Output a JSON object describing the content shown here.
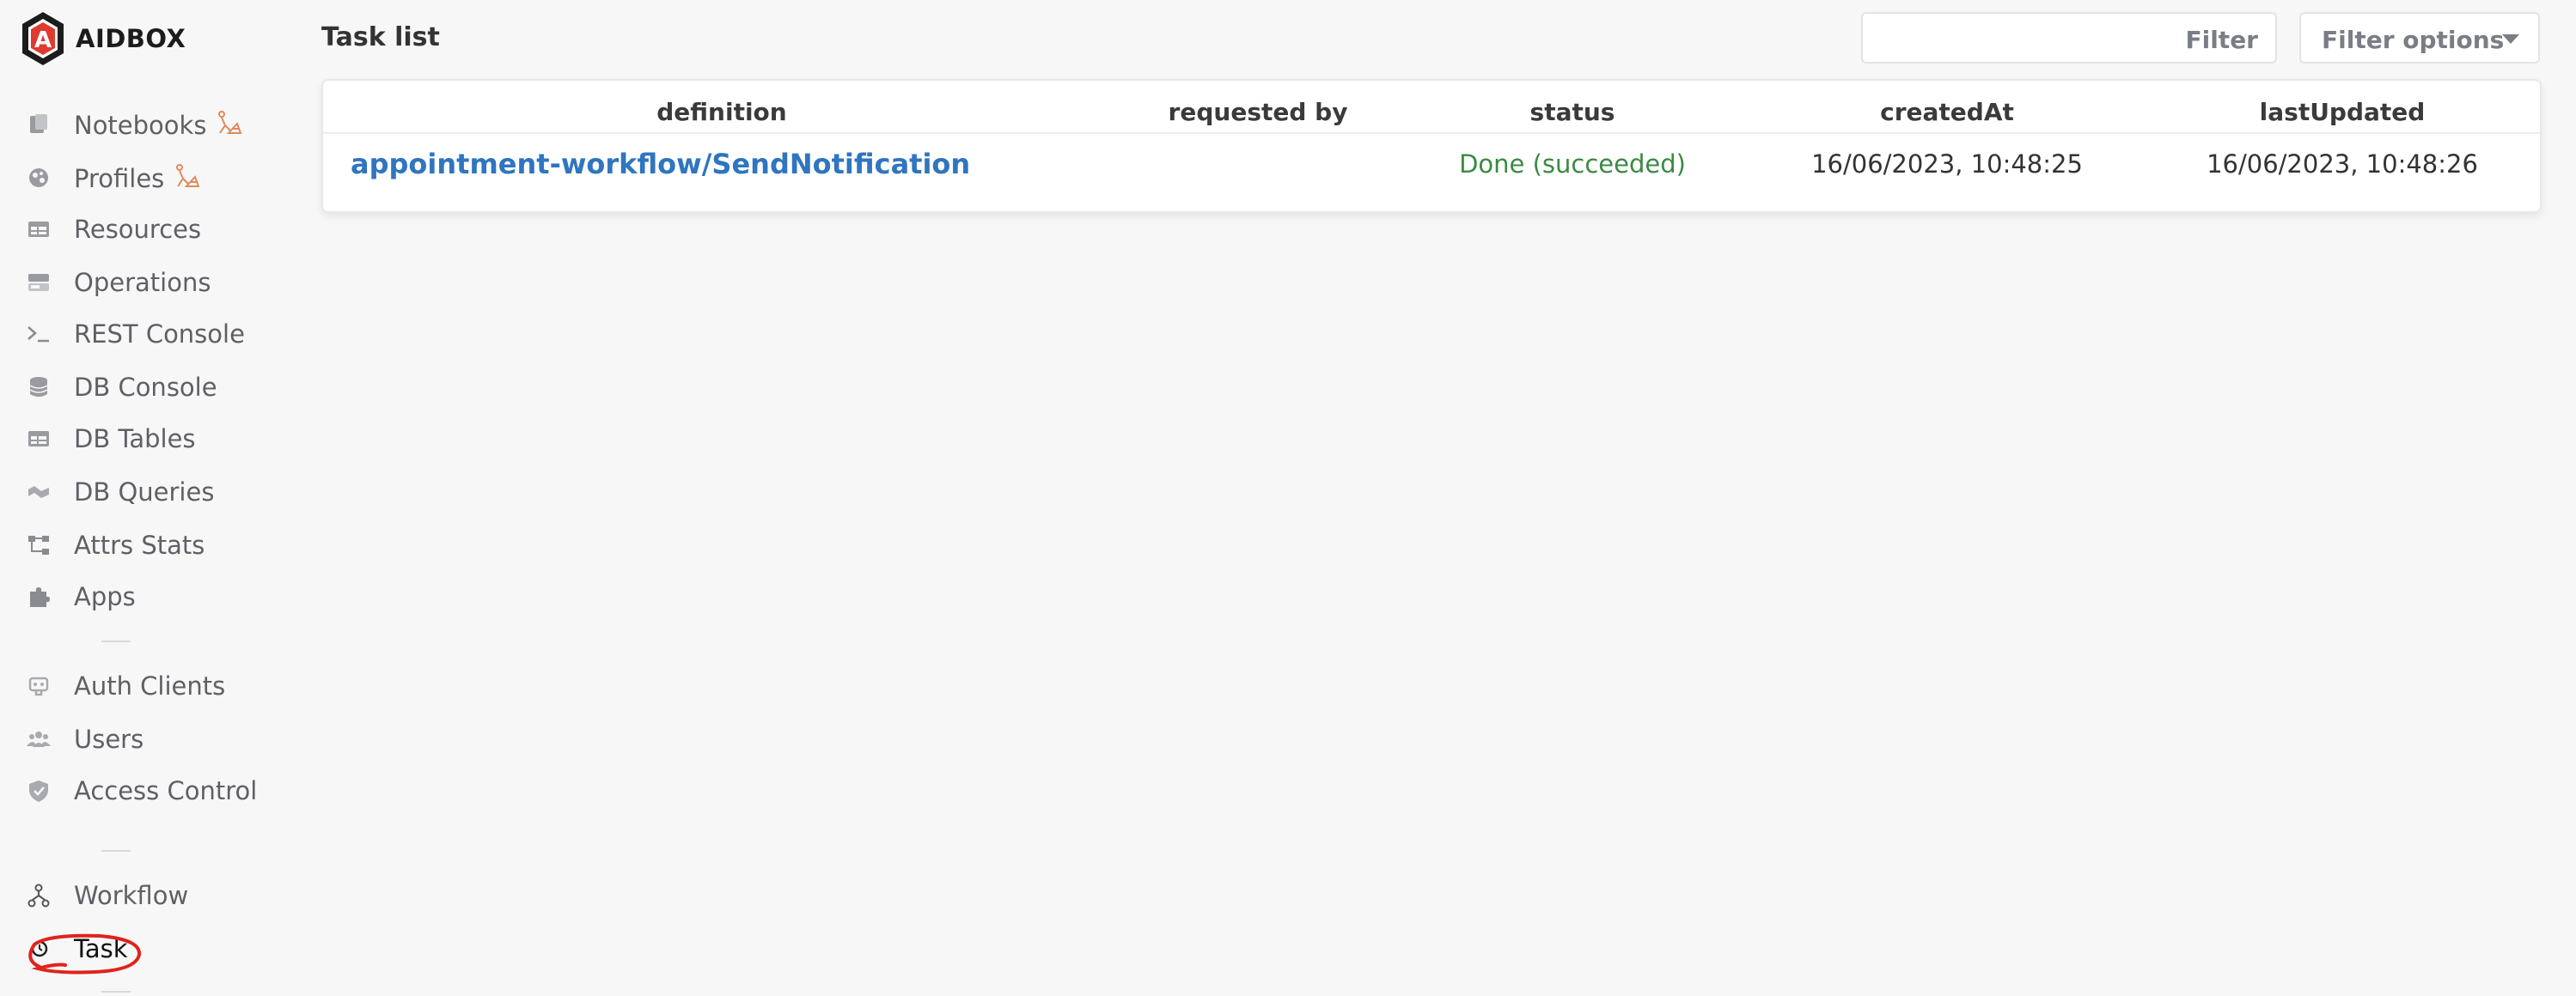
{
  "app": {
    "name": "AIDBOX"
  },
  "sidebar": {
    "items": [
      {
        "label": "Notebooks",
        "icon": "notebooks-icon",
        "wip": true
      },
      {
        "label": "Profiles",
        "icon": "profiles-icon",
        "wip": true
      },
      {
        "label": "Resources",
        "icon": "resources-icon"
      },
      {
        "label": "Operations",
        "icon": "operations-icon"
      },
      {
        "label": "REST Console",
        "icon": "rest-console-icon"
      },
      {
        "label": "DB Console",
        "icon": "db-console-icon"
      },
      {
        "label": "DB Tables",
        "icon": "db-tables-icon"
      },
      {
        "label": "DB Queries",
        "icon": "db-queries-icon"
      },
      {
        "label": "Attrs Stats",
        "icon": "attrs-stats-icon"
      },
      {
        "label": "Apps",
        "icon": "apps-icon"
      },
      {
        "label": "Auth Clients",
        "icon": "auth-clients-icon"
      },
      {
        "label": "Users",
        "icon": "users-icon"
      },
      {
        "label": "Access Control",
        "icon": "access-control-icon"
      },
      {
        "label": "Workflow",
        "icon": "workflow-icon"
      },
      {
        "label": "Task",
        "icon": "task-icon",
        "active": true
      }
    ]
  },
  "header": {
    "title": "Task list",
    "filter": {
      "value": "",
      "button_label": "Filter"
    },
    "filter_options_label": "Filter options"
  },
  "table": {
    "columns": [
      "definition",
      "requested by",
      "status",
      "createdAt",
      "lastUpdated"
    ],
    "rows": [
      {
        "definition": "appointment-workflow/SendNotification",
        "requested_by": "",
        "status": "Done (succeeded)",
        "createdAt": "16/06/2023, 10:48:25",
        "lastUpdated": "16/06/2023, 10:48:26"
      }
    ]
  },
  "colors": {
    "link": "#2f75c0",
    "status_done": "#3a8a42",
    "brand_red": "#e03a2f",
    "wip_orange": "#e08a5a",
    "annotation_red": "#e0231c"
  }
}
